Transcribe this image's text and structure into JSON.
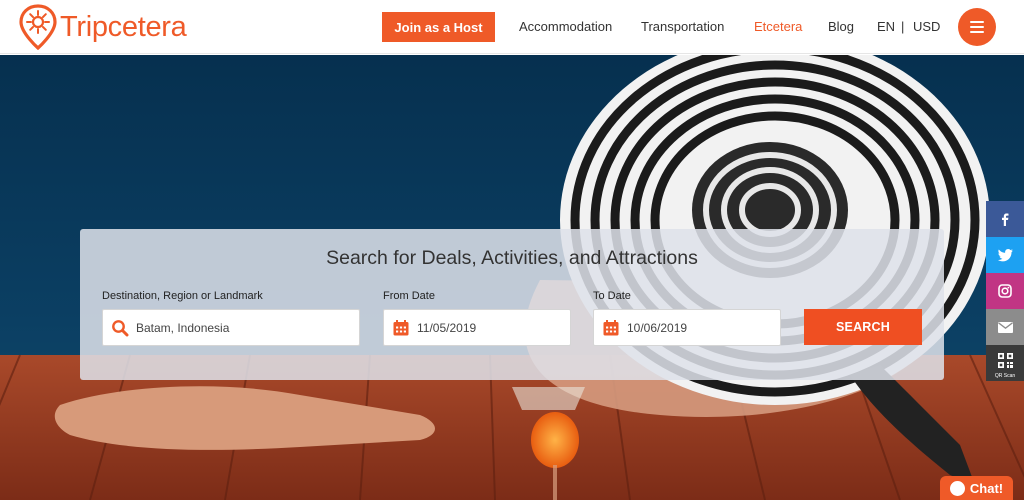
{
  "brand": {
    "name": "Tripcetera",
    "color": "#ef5a28"
  },
  "header": {
    "host_button": "Join as a Host",
    "nav": [
      {
        "label": "Accommodation",
        "active": false
      },
      {
        "label": "Transportation",
        "active": false
      },
      {
        "label": "Etcetera",
        "active": true
      },
      {
        "label": "Blog",
        "active": false
      }
    ],
    "language": "EN",
    "separator": "|",
    "currency": "USD",
    "menu_icon": "hamburger-icon"
  },
  "search": {
    "title": "Search for Deals, Activities, and Attractions",
    "destination": {
      "label": "Destination, Region or Landmark",
      "value": "Batam, Indonesia",
      "icon": "search-icon"
    },
    "from_date": {
      "label": "From Date",
      "value": "11/05/2019",
      "icon": "calendar-icon"
    },
    "to_date": {
      "label": "To Date",
      "value": "10/06/2019",
      "icon": "calendar-icon"
    },
    "button": "SEARCH"
  },
  "social": {
    "items": [
      {
        "icon": "facebook-icon",
        "color": "#3b5998"
      },
      {
        "icon": "twitter-icon",
        "color": "#1da1f2"
      },
      {
        "icon": "instagram-icon",
        "color": "#c13584"
      },
      {
        "icon": "email-icon",
        "color": "#8c8c8c"
      },
      {
        "icon": "qr-code-icon",
        "color": "#3a3a3a"
      }
    ],
    "qr_label": "QR Scan"
  },
  "chat": {
    "label": "Chat!",
    "icon": "chat-bubble-icon"
  }
}
